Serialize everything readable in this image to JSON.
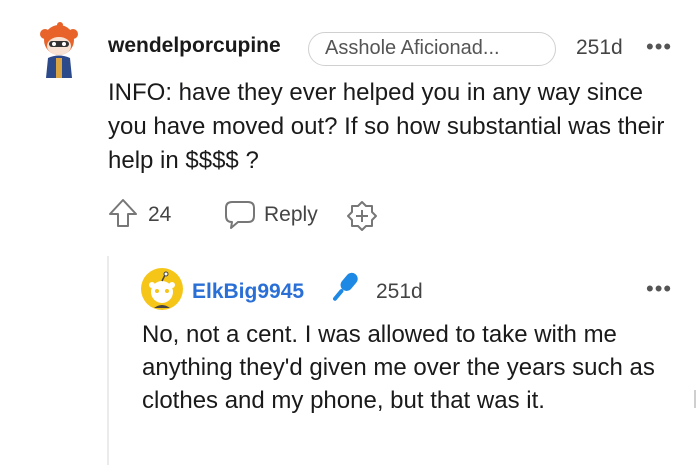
{
  "comment": {
    "username": "wendelporcupine",
    "flair": "Asshole Aficionad...",
    "age": "251d",
    "more": "•••",
    "body": "INFO: have they ever helped you in any way since you have moved out? If so how substantial was their help in $$$$ ?",
    "votes": "24",
    "reply_label": "Reply"
  },
  "reply": {
    "username": "ElkBig9945",
    "age": "251d",
    "more": "•••",
    "body": "No, not a cent. I was allowed to take with me anything they'd given me over the years such as clothes and my phone, but that was it."
  },
  "colors": {
    "username_op": "#2a6fd6",
    "mic_badge": "#1e88e5",
    "avatar_orange": "#e8632a",
    "avatar_yellow": "#f5c518"
  }
}
